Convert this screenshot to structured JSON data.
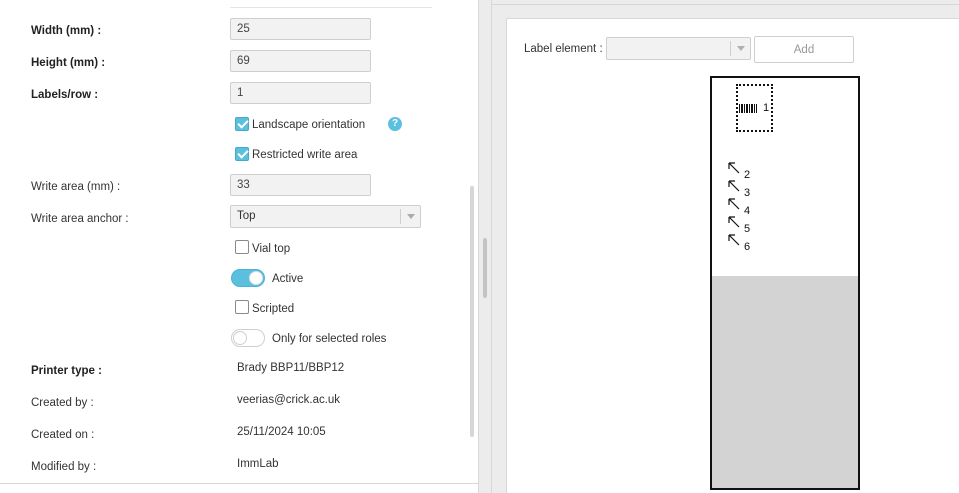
{
  "form": {
    "width_label": "Width (mm) :",
    "width_value": "25",
    "height_label": "Height (mm) :",
    "height_value": "69",
    "labels_row_label": "Labels/row :",
    "labels_row_value": "1",
    "landscape_label": "Landscape orientation",
    "landscape_checked": true,
    "restricted_label": "Restricted write area",
    "restricted_checked": true,
    "write_area_label": "Write area (mm) :",
    "write_area_value": "33",
    "anchor_label": "Write area anchor :",
    "anchor_value": "Top",
    "vial_top_label": "Vial top",
    "vial_top_checked": false,
    "active_label": "Active",
    "active_on": true,
    "scripted_label": "Scripted",
    "scripted_checked": false,
    "roles_label": "Only for selected roles",
    "roles_on": false,
    "help_glyph": "?"
  },
  "info": {
    "printer_type_label": "Printer type :",
    "printer_type_value": "Brady BBP11/BBP12",
    "created_by_label": "Created by :",
    "created_by_value": "veerias@crick.ac.uk",
    "created_on_label": "Created on :",
    "created_on_value": "25/11/2024 10:05",
    "modified_by_label": "Modified by :",
    "modified_by_value": "ImmLab"
  },
  "editor": {
    "label_element_label": "Label element :",
    "label_element_value": "",
    "add_button_label": "Add",
    "elements": [
      {
        "type": "barcode",
        "number": "1"
      },
      {
        "type": "anchor",
        "number": "2"
      },
      {
        "type": "anchor",
        "number": "3"
      },
      {
        "type": "anchor",
        "number": "4"
      },
      {
        "type": "anchor",
        "number": "5"
      },
      {
        "type": "anchor",
        "number": "6"
      }
    ]
  },
  "colors": {
    "accent": "#5bc0de",
    "restricted_area": "#d3d3d3",
    "field_bg": "#f2f2f2"
  }
}
